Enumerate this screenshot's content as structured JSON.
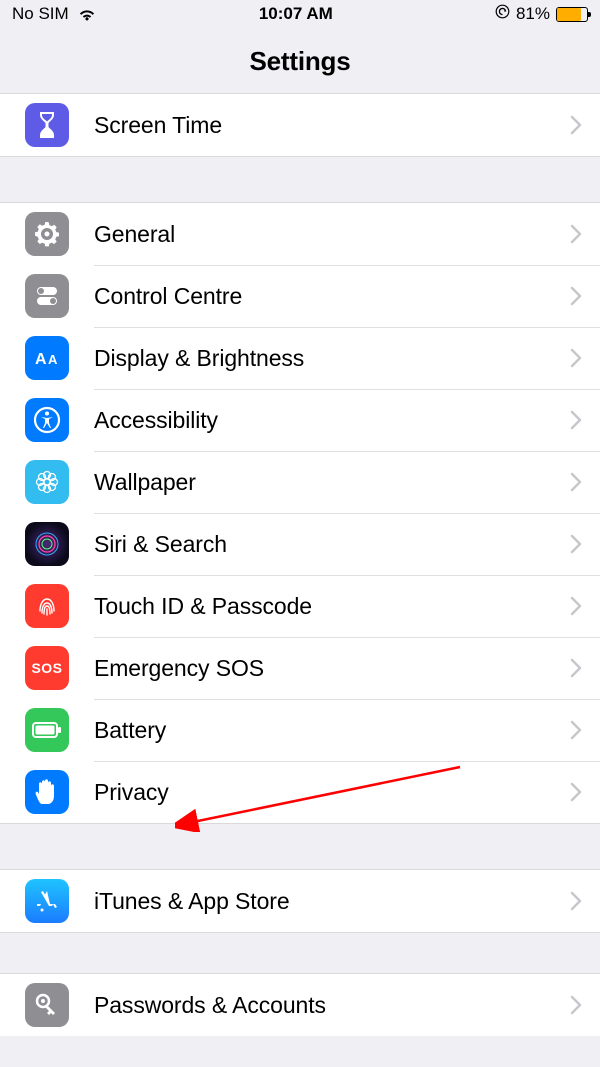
{
  "statusBar": {
    "carrier": "No SIM",
    "time": "10:07 AM",
    "batteryPct": "81%"
  },
  "header": {
    "title": "Settings"
  },
  "group0": {
    "item0": {
      "label": "Screen Time",
      "icon": "hourglass-icon",
      "iconBg": "#5e5ce6"
    }
  },
  "group1": {
    "item0": {
      "label": "General",
      "icon": "gear-icon",
      "iconBg": "#8e8e93"
    },
    "item1": {
      "label": "Control Centre",
      "icon": "toggles-icon",
      "iconBg": "#8e8e93"
    },
    "item2": {
      "label": "Display & Brightness",
      "icon": "text-size-icon",
      "iconBg": "#007aff"
    },
    "item3": {
      "label": "Accessibility",
      "icon": "accessibility-icon",
      "iconBg": "#007aff"
    },
    "item4": {
      "label": "Wallpaper",
      "icon": "flower-icon",
      "iconBg": "#33bcef"
    },
    "item5": {
      "label": "Siri & Search",
      "icon": "siri-icon",
      "iconBg": "#000000"
    },
    "item6": {
      "label": "Touch ID & Passcode",
      "icon": "fingerprint-icon",
      "iconBg": "#ff3b30"
    },
    "item7": {
      "label": "Emergency SOS",
      "icon": "sos-icon",
      "iconBg": "#ff3b30"
    },
    "item8": {
      "label": "Battery",
      "icon": "battery-icon",
      "iconBg": "#34c759"
    },
    "item9": {
      "label": "Privacy",
      "icon": "hand-icon",
      "iconBg": "#007aff"
    }
  },
  "group2": {
    "item0": {
      "label": "iTunes & App Store",
      "icon": "appstore-icon",
      "iconBg": "#1fa7ff"
    }
  },
  "group3": {
    "item0": {
      "label": "Passwords & Accounts",
      "icon": "key-icon",
      "iconBg": "#8e8e93"
    }
  },
  "annotation": {
    "arrowTarget": "privacy-row"
  }
}
